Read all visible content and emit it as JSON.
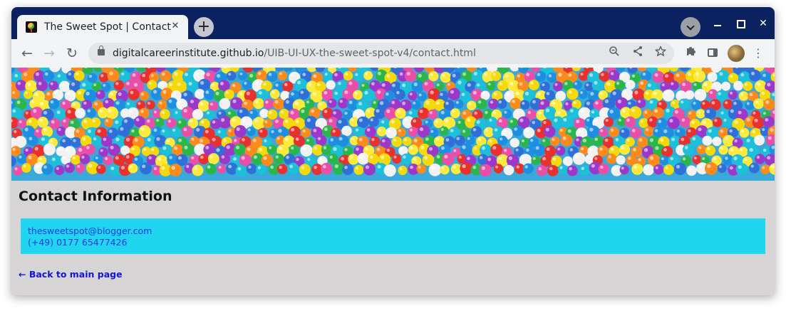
{
  "browser": {
    "tab_title": "The Sweet Spot | Contact",
    "tab_close": "✕",
    "new_tab": "+",
    "url_host": "digitalcareerinstitute.github.io",
    "url_path": "/UIB-UI-UX-the-sweet-spot-v4/contact.html",
    "back": "←",
    "forward": "→",
    "reload": "↻",
    "window_close": "✕"
  },
  "page": {
    "heading": "Contact Information",
    "email": "thesweetspot@blogger.com",
    "phone": "(+49) 0177 65477426",
    "back_link": "← Back to main page"
  },
  "colors": {
    "title_bar": "#0c2260",
    "page_background": "#d6d4d4",
    "contact_box": "#20d5f0",
    "link": "#1a3be0"
  },
  "icons": [
    "favicon",
    "new-tab-icon",
    "tab-search-icon",
    "minimize-icon",
    "maximize-icon",
    "close-icon",
    "back-icon",
    "forward-icon",
    "reload-icon",
    "lock-icon",
    "zoom-icon",
    "share-icon",
    "bookmark-star-icon",
    "extensions-icon",
    "side-panel-icon",
    "avatar",
    "menu-icon"
  ]
}
